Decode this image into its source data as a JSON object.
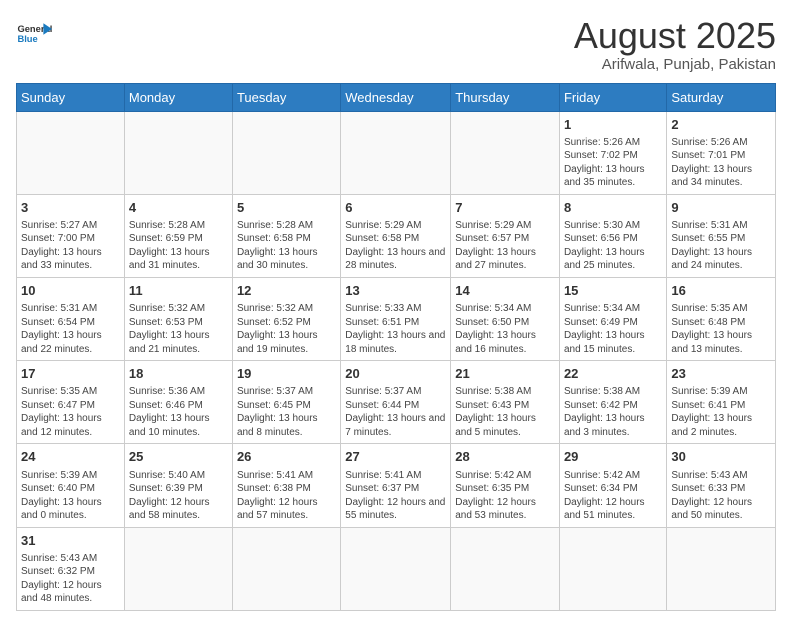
{
  "header": {
    "logo_general": "General",
    "logo_blue": "Blue",
    "title": "August 2025",
    "subtitle": "Arifwala, Punjab, Pakistan"
  },
  "weekdays": [
    "Sunday",
    "Monday",
    "Tuesday",
    "Wednesday",
    "Thursday",
    "Friday",
    "Saturday"
  ],
  "weeks": [
    [
      {
        "day": "",
        "info": ""
      },
      {
        "day": "",
        "info": ""
      },
      {
        "day": "",
        "info": ""
      },
      {
        "day": "",
        "info": ""
      },
      {
        "day": "",
        "info": ""
      },
      {
        "day": "1",
        "info": "Sunrise: 5:26 AM\nSunset: 7:02 PM\nDaylight: 13 hours\nand 35 minutes."
      },
      {
        "day": "2",
        "info": "Sunrise: 5:26 AM\nSunset: 7:01 PM\nDaylight: 13 hours\nand 34 minutes."
      }
    ],
    [
      {
        "day": "3",
        "info": "Sunrise: 5:27 AM\nSunset: 7:00 PM\nDaylight: 13 hours\nand 33 minutes."
      },
      {
        "day": "4",
        "info": "Sunrise: 5:28 AM\nSunset: 6:59 PM\nDaylight: 13 hours\nand 31 minutes."
      },
      {
        "day": "5",
        "info": "Sunrise: 5:28 AM\nSunset: 6:58 PM\nDaylight: 13 hours\nand 30 minutes."
      },
      {
        "day": "6",
        "info": "Sunrise: 5:29 AM\nSunset: 6:58 PM\nDaylight: 13 hours\nand 28 minutes."
      },
      {
        "day": "7",
        "info": "Sunrise: 5:29 AM\nSunset: 6:57 PM\nDaylight: 13 hours\nand 27 minutes."
      },
      {
        "day": "8",
        "info": "Sunrise: 5:30 AM\nSunset: 6:56 PM\nDaylight: 13 hours\nand 25 minutes."
      },
      {
        "day": "9",
        "info": "Sunrise: 5:31 AM\nSunset: 6:55 PM\nDaylight: 13 hours\nand 24 minutes."
      }
    ],
    [
      {
        "day": "10",
        "info": "Sunrise: 5:31 AM\nSunset: 6:54 PM\nDaylight: 13 hours\nand 22 minutes."
      },
      {
        "day": "11",
        "info": "Sunrise: 5:32 AM\nSunset: 6:53 PM\nDaylight: 13 hours\nand 21 minutes."
      },
      {
        "day": "12",
        "info": "Sunrise: 5:32 AM\nSunset: 6:52 PM\nDaylight: 13 hours\nand 19 minutes."
      },
      {
        "day": "13",
        "info": "Sunrise: 5:33 AM\nSunset: 6:51 PM\nDaylight: 13 hours\nand 18 minutes."
      },
      {
        "day": "14",
        "info": "Sunrise: 5:34 AM\nSunset: 6:50 PM\nDaylight: 13 hours\nand 16 minutes."
      },
      {
        "day": "15",
        "info": "Sunrise: 5:34 AM\nSunset: 6:49 PM\nDaylight: 13 hours\nand 15 minutes."
      },
      {
        "day": "16",
        "info": "Sunrise: 5:35 AM\nSunset: 6:48 PM\nDaylight: 13 hours\nand 13 minutes."
      }
    ],
    [
      {
        "day": "17",
        "info": "Sunrise: 5:35 AM\nSunset: 6:47 PM\nDaylight: 13 hours\nand 12 minutes."
      },
      {
        "day": "18",
        "info": "Sunrise: 5:36 AM\nSunset: 6:46 PM\nDaylight: 13 hours\nand 10 minutes."
      },
      {
        "day": "19",
        "info": "Sunrise: 5:37 AM\nSunset: 6:45 PM\nDaylight: 13 hours\nand 8 minutes."
      },
      {
        "day": "20",
        "info": "Sunrise: 5:37 AM\nSunset: 6:44 PM\nDaylight: 13 hours\nand 7 minutes."
      },
      {
        "day": "21",
        "info": "Sunrise: 5:38 AM\nSunset: 6:43 PM\nDaylight: 13 hours\nand 5 minutes."
      },
      {
        "day": "22",
        "info": "Sunrise: 5:38 AM\nSunset: 6:42 PM\nDaylight: 13 hours\nand 3 minutes."
      },
      {
        "day": "23",
        "info": "Sunrise: 5:39 AM\nSunset: 6:41 PM\nDaylight: 13 hours\nand 2 minutes."
      }
    ],
    [
      {
        "day": "24",
        "info": "Sunrise: 5:39 AM\nSunset: 6:40 PM\nDaylight: 13 hours\nand 0 minutes."
      },
      {
        "day": "25",
        "info": "Sunrise: 5:40 AM\nSunset: 6:39 PM\nDaylight: 12 hours\nand 58 minutes."
      },
      {
        "day": "26",
        "info": "Sunrise: 5:41 AM\nSunset: 6:38 PM\nDaylight: 12 hours\nand 57 minutes."
      },
      {
        "day": "27",
        "info": "Sunrise: 5:41 AM\nSunset: 6:37 PM\nDaylight: 12 hours\nand 55 minutes."
      },
      {
        "day": "28",
        "info": "Sunrise: 5:42 AM\nSunset: 6:35 PM\nDaylight: 12 hours\nand 53 minutes."
      },
      {
        "day": "29",
        "info": "Sunrise: 5:42 AM\nSunset: 6:34 PM\nDaylight: 12 hours\nand 51 minutes."
      },
      {
        "day": "30",
        "info": "Sunrise: 5:43 AM\nSunset: 6:33 PM\nDaylight: 12 hours\nand 50 minutes."
      }
    ],
    [
      {
        "day": "31",
        "info": "Sunrise: 5:43 AM\nSunset: 6:32 PM\nDaylight: 12 hours\nand 48 minutes."
      },
      {
        "day": "",
        "info": ""
      },
      {
        "day": "",
        "info": ""
      },
      {
        "day": "",
        "info": ""
      },
      {
        "day": "",
        "info": ""
      },
      {
        "day": "",
        "info": ""
      },
      {
        "day": "",
        "info": ""
      }
    ]
  ]
}
